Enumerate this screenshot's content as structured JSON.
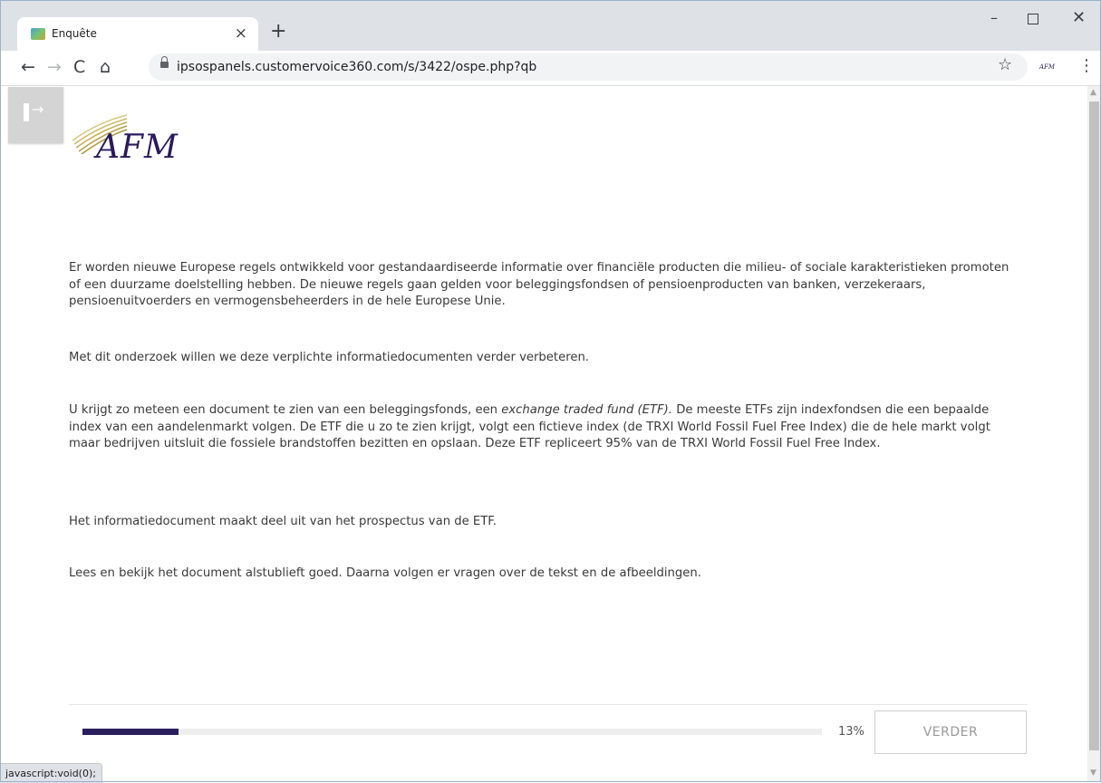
{
  "browser": {
    "tab_title": "Enquête",
    "tab_close": "×",
    "new_tab": "+",
    "url": "ipsospanels.customervoice360.com/s/3422/ospe.php?qb",
    "window_minimize": "–",
    "window_close": "✕",
    "back": "←",
    "forward": "→",
    "reload": "C",
    "home": "⌂",
    "bookmark": "☆",
    "menu": "⋮",
    "extension_label": "AFM",
    "status_text": "javascript:void(0);"
  },
  "page": {
    "logo_text": "AFM",
    "sidebar_arrow": "→",
    "paragraph1": "Er worden nieuwe Europese regels ontwikkeld voor gestandaardiseerde informatie over financiële producten die milieu- of sociale karakteristieken promoten of een duurzame doelstelling hebben. De nieuwe regels gaan gelden voor beleggingsfondsen of pensioenproducten van banken, verzekeraars, pensioenuitvoerders en vermogensbeheerders in de hele Europese Unie.",
    "paragraph2": "Met dit onderzoek willen we deze verplichte informatiedocumenten verder verbeteren.",
    "paragraph3_start": "U krijgt zo meteen een document te zien van een beleggingsfonds, een ",
    "paragraph3_italic": "exchange traded fund (ETF).",
    "paragraph3_end": " De meeste ETFs zijn indexfondsen die een bepaalde index van een aandelenmarkt volgen. De ETF die u zo te zien krijgt, volgt een fictieve index (de TRXI World Fossil Fuel Free Index) die de hele markt volgt maar bedrijven uitsluit die fossiele brandstoffen bezitten en opslaan. Deze ETF repliceert 95% van de TRXI World Fossil Fuel Free Index.",
    "paragraph4": "Het informatiedocument maakt deel uit van het prospectus van de ETF.",
    "paragraph5": "Lees en bekijk het document alstublieft goed. Daarna volgen er vragen over de tekst en de afbeeldingen."
  },
  "progress": {
    "value": 0.13,
    "label": "13%"
  },
  "next_button": "VERDER",
  "colors": {
    "brand": "#2c1f5e",
    "logo_gold": "#c9b25a"
  }
}
